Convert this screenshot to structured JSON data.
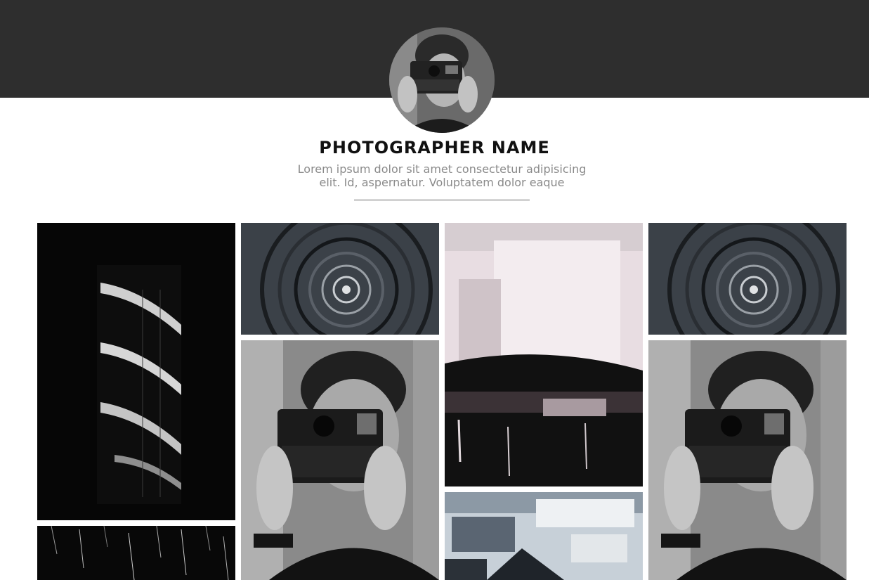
{
  "profile": {
    "name": "PHOTOGRAPHER NAME",
    "bio": "Lorem ipsum dolor sit amet consectetur adipisicing elit. Id, aspernatur. Voluptatem dolor eaque"
  },
  "colors": {
    "banner": "#2e2e2e",
    "page_background": "#ffffff",
    "bio_text": "#8a8a8a",
    "name_text": "#111111"
  },
  "gallery": {
    "images": [
      {
        "subject": "spiral-staircase-photo"
      },
      {
        "subject": "star-trails-photo"
      },
      {
        "subject": "fractal-spiral-photo"
      },
      {
        "subject": "person-with-polaroid-camera-photo"
      },
      {
        "subject": "abstract-paint-photo"
      },
      {
        "subject": "abstract-paint-blue-photo"
      },
      {
        "subject": "fractal-spiral-photo"
      },
      {
        "subject": "person-with-polaroid-camera-photo"
      }
    ]
  }
}
